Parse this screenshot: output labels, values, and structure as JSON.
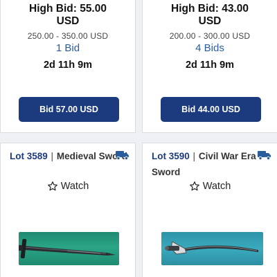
{
  "lots_top": [
    {
      "high_bid": "High Bid: 55.00",
      "currency": "USD",
      "estimate": "250.00 - 350.00 USD",
      "bid_count": "1 Bid",
      "time_left": "2d 11h 9m",
      "bid_button": "Bid 57.00 USD"
    },
    {
      "high_bid": "High Bid: 43.00",
      "currency": "USD",
      "estimate": "200.00 - 300.00 USD",
      "bid_count": "4 Bids",
      "time_left": "2d 11h 9m",
      "bid_button": "Bid 44.00 USD"
    }
  ],
  "lots_bottom": [
    {
      "lot_number": "Lot 3589",
      "separator": "|",
      "title": "Medieval Sword",
      "watch_label": "Watch",
      "shipping_icon": "truck-icon",
      "watch_icon": "star-outline-icon"
    },
    {
      "lot_number": "Lot 3590",
      "separator": "|",
      "title": "Civil War Era Sword",
      "watch_label": "Watch",
      "shipping_icon": "truck-icon",
      "watch_icon": "star-outline-icon"
    }
  ],
  "colors": {
    "accent": "#1c3a7e",
    "link": "#2a5d9b",
    "background": "#eef0f3"
  }
}
